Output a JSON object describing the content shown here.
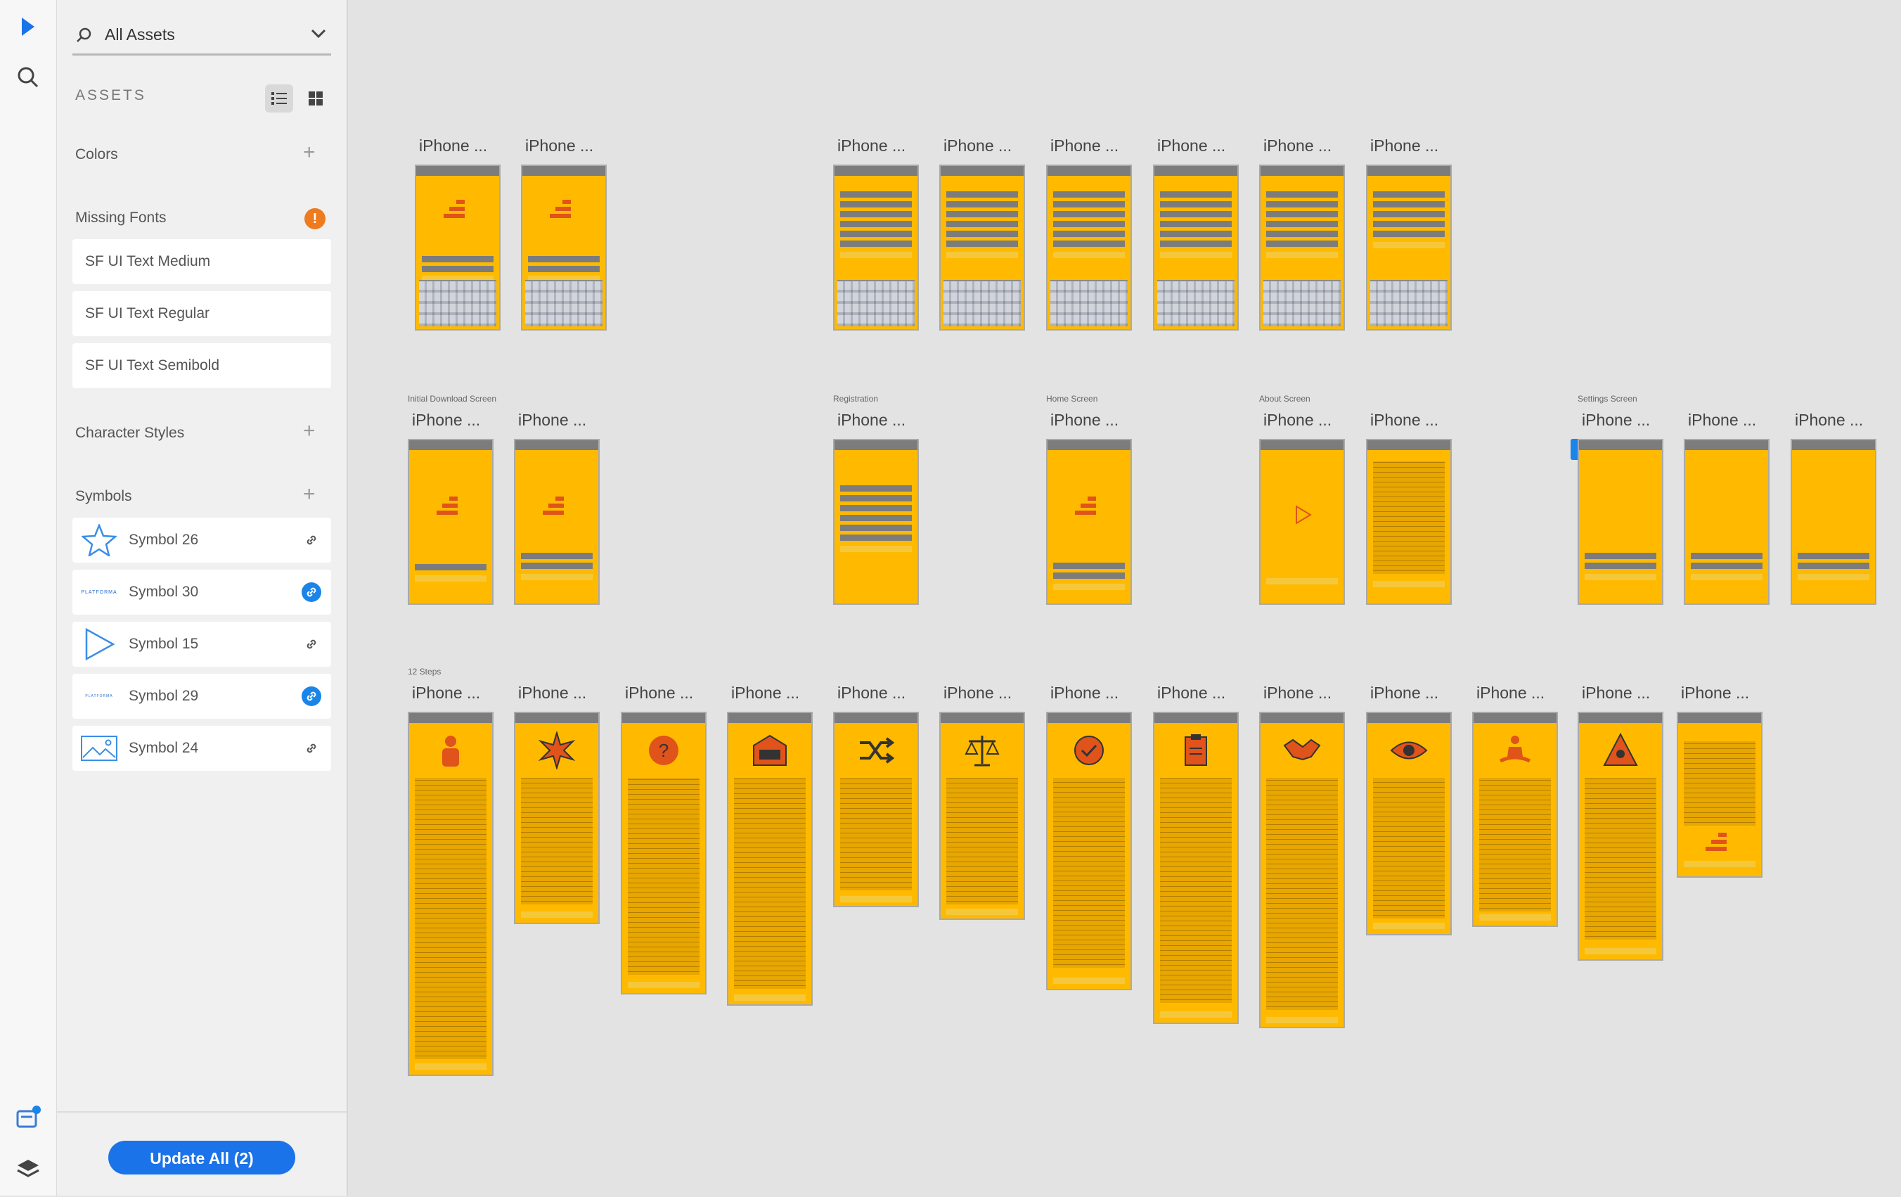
{
  "sidebar": {
    "search": {
      "value": "All Assets"
    },
    "assets_title": "ASSETS",
    "sections": {
      "colors": "Colors",
      "missing_fonts": "Missing Fonts",
      "character_styles": "Character Styles",
      "symbols": "Symbols"
    },
    "missing_fonts": [
      "SF UI Text Medium",
      "SF UI Text Regular",
      "SF UI Text Semibold"
    ],
    "symbols": [
      {
        "label": "Symbol 26",
        "thumb": "star-icon",
        "link_active": false
      },
      {
        "label": "Symbol 30",
        "thumb": "platforma-logo",
        "thumb_text": "PLATFORMA",
        "link_active": true
      },
      {
        "label": "Symbol 15",
        "thumb": "play-triangle-icon",
        "link_active": false
      },
      {
        "label": "Symbol 29",
        "thumb": "platforma-logo-small",
        "thumb_text": "PLATFORMA",
        "link_active": true
      },
      {
        "label": "Symbol 24",
        "thumb": "image-placeholder-icon",
        "link_active": false
      }
    ],
    "warning_glyph": "!",
    "update_button": "Update All (2)"
  },
  "colors": {
    "accent": "#1a73e8",
    "artboard": "#ffba00",
    "artboard_dark": "#e7a600",
    "statusbar": "#7c7c7c",
    "logo": "#e0531b",
    "warning": "#ee7b1f"
  },
  "canvas": {
    "artboard_label": "iPhone ...",
    "groups": {
      "initial_download": "Initial Download Screen",
      "registration": "Registration",
      "home": "Home Screen",
      "about": "About Screen",
      "settings": "Settings Screen",
      "steps": "12 Steps"
    }
  }
}
